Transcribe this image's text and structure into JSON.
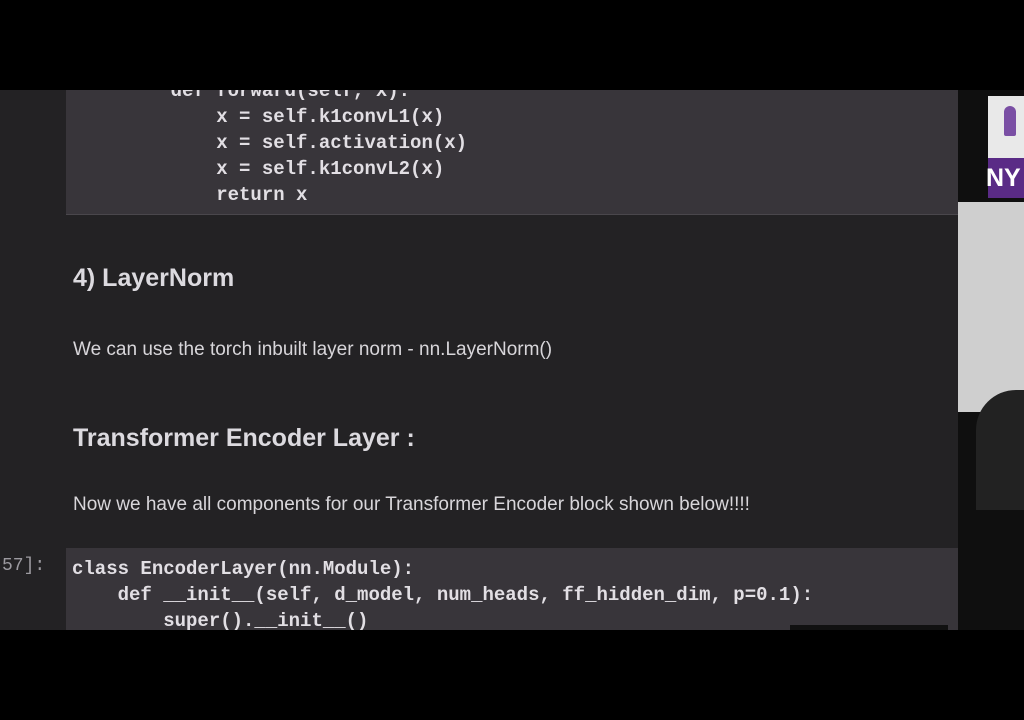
{
  "code_cell_top": {
    "lines": [
      "    def forward(self, x):",
      "        x = self.k1convL1(x)",
      "        x = self.activation(x)",
      "        x = self.k1convL2(x)",
      "        return x"
    ]
  },
  "markdown": {
    "layernorm_heading": "4) LayerNorm",
    "layernorm_text": "We can use the torch inbuilt layer norm - nn.LayerNorm()",
    "encoder_heading": "Transformer Encoder Layer :",
    "encoder_text": "Now we have all components for our Transformer Encoder block shown below!!!!"
  },
  "code_cell_bottom": {
    "prompt": "57]:",
    "lines": [
      "class EncoderLayer(nn.Module):",
      "    def __init__(self, d_model, num_heads, ff_hidden_dim, p=0.1):",
      "        super().__init__()"
    ]
  },
  "webcam": {
    "logo_text": "NY"
  }
}
